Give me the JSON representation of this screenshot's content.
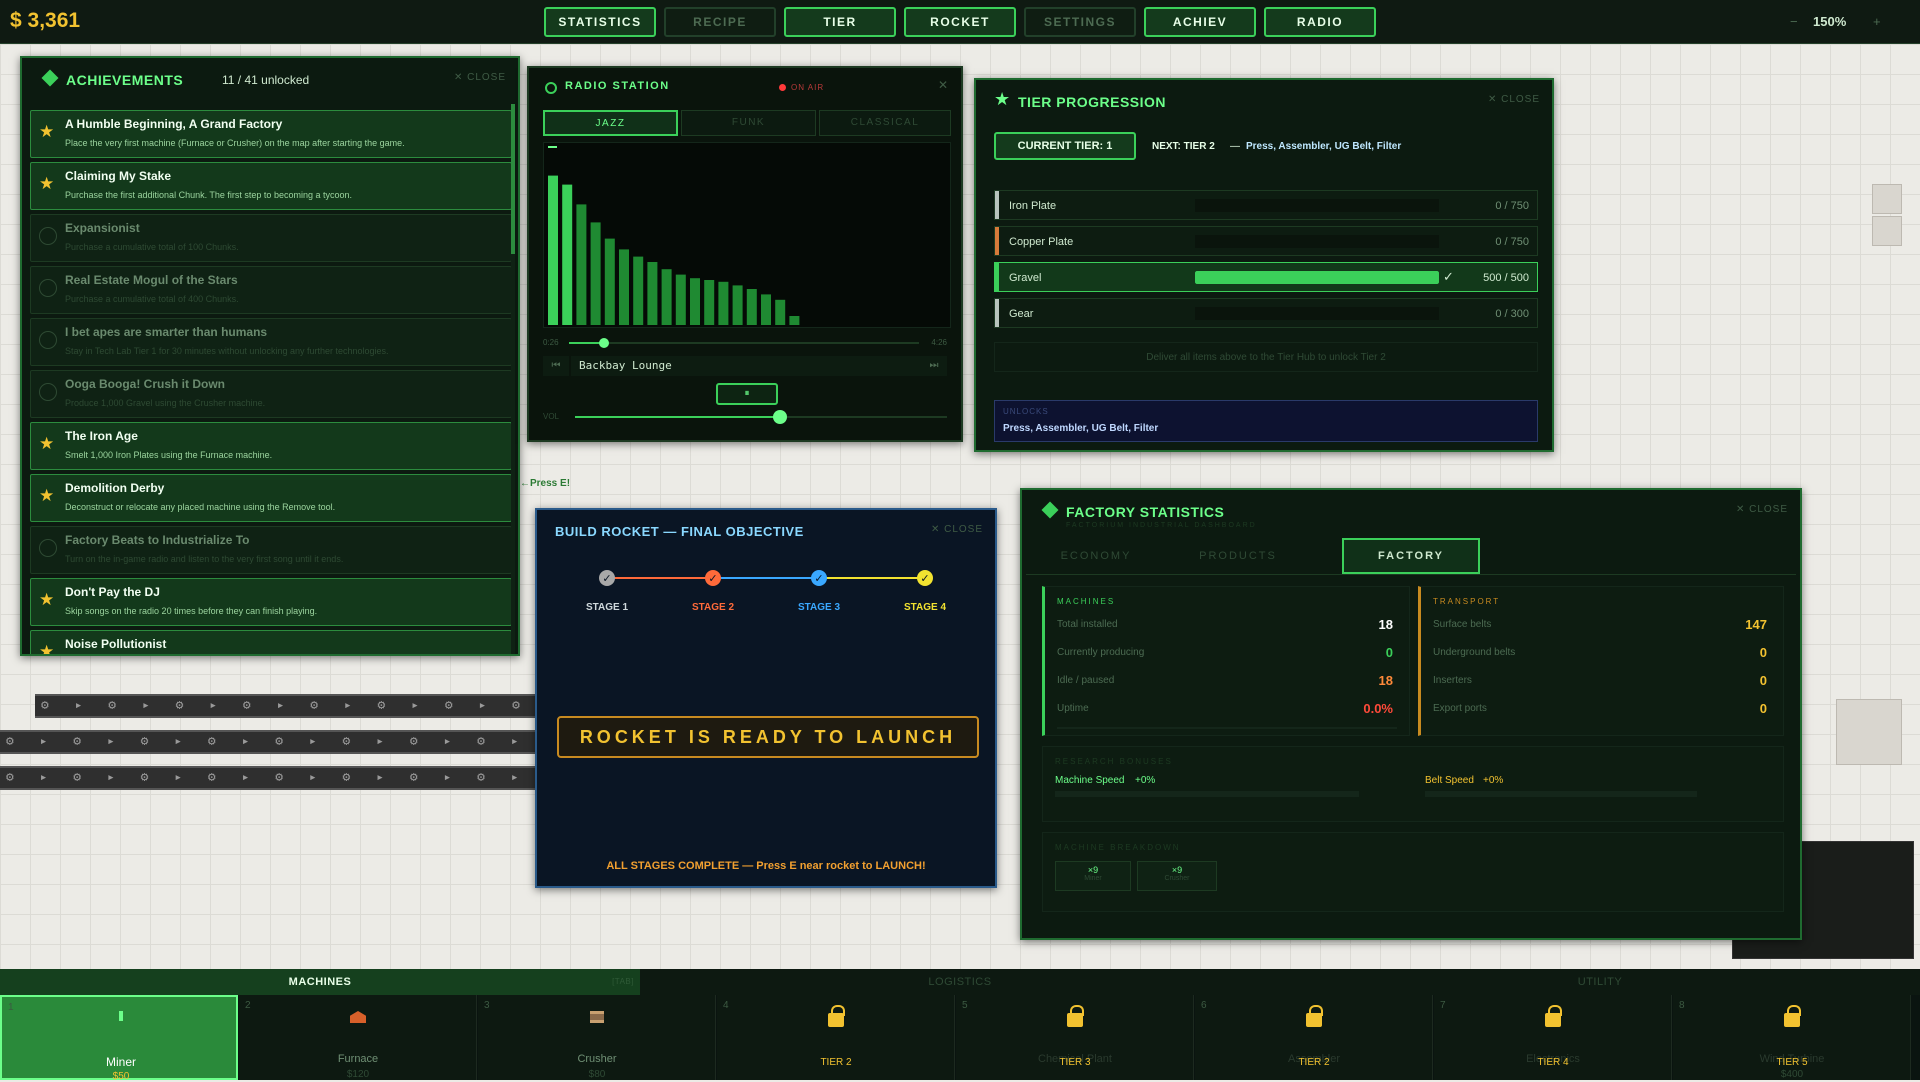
{
  "hud": {
    "money": "$ 3,361",
    "zoom": "150%",
    "zoom_minus": "−",
    "zoom_plus": "+"
  },
  "nav": [
    "STATISTICS",
    "RECIPE",
    "TIER",
    "ROCKET",
    "SETTINGS",
    "ACHIEV",
    "RADIO"
  ],
  "nav_disabled": [
    "RECIPE",
    "SETTINGS"
  ],
  "world": {
    "belt_glyphs": "⚙ ▸ ⚙ ▸ ⚙ ▸ ⚙ ▸ ⚙ ▸ ⚙ ▸ ⚙ ▸ ⚙ ▸ ⚙ ▸ ⚙ ▸ ⚙ ▸ ⚙ ▸ ⚙ ▸ ⚙ ▸ ⚙ ▸",
    "hint": "←Press E!"
  },
  "achievements": {
    "title": "ACHIEVEMENTS",
    "count": "11 / 41 unlocked",
    "close": "✕ CLOSE",
    "icon": "diamond-icon",
    "items": [
      {
        "title": "A Humble Beginning, A Grand Factory",
        "desc": "Place the very first machine (Furnace or Crusher) on the map after starting the game.",
        "unlocked": true
      },
      {
        "title": "Claiming My Stake",
        "desc": "Purchase the first additional Chunk. The first step to becoming a tycoon.",
        "unlocked": true
      },
      {
        "title": "Expansionist",
        "desc": "Purchase a cumulative total of 100 Chunks.",
        "unlocked": false
      },
      {
        "title": "Real Estate Mogul of the Stars",
        "desc": "Purchase a cumulative total of 400 Chunks.",
        "unlocked": false
      },
      {
        "title": "I bet apes are smarter than humans",
        "desc": "Stay in Tech Lab Tier 1 for 30 minutes without unlocking any further technologies.",
        "unlocked": false
      },
      {
        "title": "Ooga Booga! Crush it Down",
        "desc": "Produce 1,000 Gravel using the Crusher machine.",
        "unlocked": false
      },
      {
        "title": "The Iron Age",
        "desc": "Smelt 1,000 Iron Plates using the Furnace machine.",
        "unlocked": true
      },
      {
        "title": "Demolition Derby",
        "desc": "Deconstruct or relocate any placed machine using the Remove tool.",
        "unlocked": true
      },
      {
        "title": "Factory Beats to Industrialize To",
        "desc": "Turn on the in-game radio and listen to the very first song until it ends.",
        "unlocked": false
      },
      {
        "title": "Don't Pay the DJ",
        "desc": "Skip songs on the radio 20 times before they can finish playing.",
        "unlocked": true
      },
      {
        "title": "Noise Pollutionist",
        "desc": "",
        "unlocked": true
      }
    ]
  },
  "radio": {
    "title": "RADIO STATION",
    "status": "ON AIR",
    "tabs": [
      "JAZZ",
      "FUNK",
      "CLASSICAL"
    ],
    "active_tab": "JAZZ",
    "time_start": "0:26",
    "time_end": "4:26",
    "track": "Backbay Lounge",
    "progress": 0.1,
    "volume_label": "VOL",
    "volume": 0.55,
    "prev": "⏮",
    "next": "⏭",
    "pause": "⏸",
    "levels": [
      0.83,
      0.78,
      0.67,
      0.57,
      0.48,
      0.42,
      0.38,
      0.35,
      0.31,
      0.28,
      0.26,
      0.25,
      0.24,
      0.22,
      0.2,
      0.17,
      0.14,
      0.05
    ]
  },
  "tier": {
    "title": "TIER PROGRESSION",
    "close": "✕ CLOSE",
    "current": "CURRENT TIER: 1",
    "next_label": "NEXT: TIER 2",
    "next_items": "Press, Assembler, UG Belt, Filter",
    "hint": "Deliver all items above to the Tier Hub to unlock Tier 2",
    "requirements": [
      {
        "name": "Iron Plate",
        "count": "0 / 750",
        "progress": 0,
        "done": false,
        "color": "#b8c4bd"
      },
      {
        "name": "Copper Plate",
        "count": "0 / 750",
        "progress": 0,
        "done": false,
        "color": "#d77a3a"
      },
      {
        "name": "Gravel",
        "count": "500 / 500",
        "progress": 1,
        "done": true,
        "color": "#3bd05a"
      },
      {
        "name": "Gear",
        "count": "0 / 300",
        "progress": 0,
        "done": false,
        "color": "#b8c4bd"
      }
    ],
    "unlocks_label": "UNLOCKS",
    "unlocks": "Press, Assembler, UG Belt, Filter",
    "check": "✓"
  },
  "rocket": {
    "title": "BUILD ROCKET — FINAL OBJECTIVE",
    "close": "✕ CLOSE",
    "stages": [
      {
        "label": "STAGE 1",
        "color": "#a8a8a8"
      },
      {
        "label": "STAGE 2",
        "color": "#ff6a3a"
      },
      {
        "label": "STAGE 3",
        "color": "#3aa8ff"
      },
      {
        "label": "STAGE 4",
        "color": "#f2e230"
      }
    ],
    "ready": "ROCKET IS READY TO LAUNCH",
    "footer": "ALL STAGES COMPLETE — Press E near rocket to LAUNCH!"
  },
  "stats": {
    "title": "FACTORY STATISTICS",
    "subtitle": "FACTORIUM INDUSTRIAL DASHBOARD",
    "close": "✕ CLOSE",
    "tabs": [
      "ECONOMY",
      "PRODUCTS",
      "FACTORY"
    ],
    "active_tab": "FACTORY",
    "machines": {
      "header": "MACHINES",
      "rows": [
        {
          "label": "Total installed",
          "value": "18",
          "color": "#ffffff"
        },
        {
          "label": "Currently producing",
          "value": "0",
          "color": "#3bd05a"
        },
        {
          "label": "Idle / paused",
          "value": "18",
          "color": "#ff8a3a"
        },
        {
          "label": "Uptime",
          "value": "0.0%",
          "color": "#ff4a3a"
        }
      ]
    },
    "transport": {
      "header": "TRANSPORT",
      "rows": [
        {
          "label": "Surface belts",
          "value": "147"
        },
        {
          "label": "Underground belts",
          "value": "0"
        },
        {
          "label": "Inserters",
          "value": "0"
        },
        {
          "label": "Export ports",
          "value": "0"
        }
      ]
    },
    "research_header": "RESEARCH BONUSES",
    "research": [
      {
        "label": "Machine Speed",
        "value": "+0%"
      },
      {
        "label": "Belt Speed",
        "value": "+0%"
      }
    ],
    "breakdown_header": "MACHINE BREAKDOWN",
    "breakdown": [
      {
        "count": "×9",
        "name": "Miner"
      },
      {
        "count": "×9",
        "name": "Crusher"
      }
    ]
  },
  "bottom": {
    "tabs": [
      "MACHINES",
      "LOGISTICS",
      "UTILITY"
    ],
    "tab_hint": "[TAB]",
    "slots": [
      {
        "num": "1",
        "name": "Miner",
        "price": "$50",
        "locked": false,
        "active": true,
        "icon": "miner-icon"
      },
      {
        "num": "2",
        "name": "Furnace",
        "price": "$120",
        "locked": false,
        "active": false,
        "icon": "furnace-icon"
      },
      {
        "num": "3",
        "name": "Crusher",
        "price": "$80",
        "locked": false,
        "active": false,
        "icon": "crusher-icon"
      },
      {
        "num": "4",
        "name": "",
        "price": "",
        "locked": true,
        "tier": "TIER 2"
      },
      {
        "num": "5",
        "name": "Chemical Plant",
        "price": "",
        "locked": true,
        "tier": "TIER 3"
      },
      {
        "num": "6",
        "name": "Assembler",
        "price": "",
        "locked": true,
        "tier": "TIER 2"
      },
      {
        "num": "7",
        "name": "Electronics",
        "price": "",
        "locked": true,
        "tier": "TIER 4"
      },
      {
        "num": "8",
        "name": "Wind Turbine",
        "price": "$400",
        "locked": true,
        "tier": "TIER 5"
      }
    ]
  }
}
